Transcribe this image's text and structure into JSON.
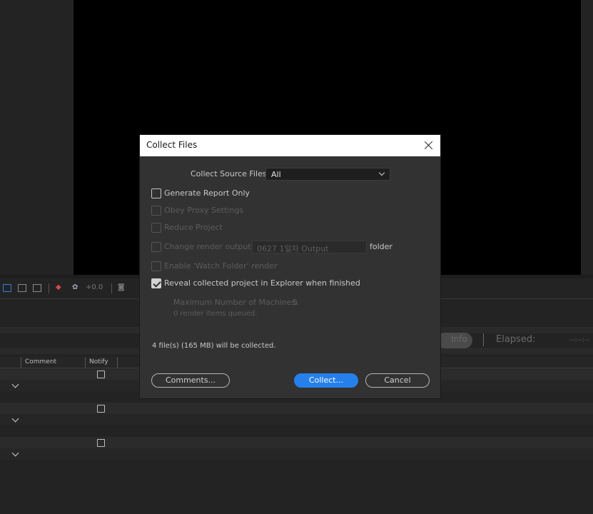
{
  "background": {
    "toolbar": {
      "exposure_value": "+0.0"
    },
    "render_queue": {
      "columns": [
        "Comment",
        "Notify"
      ],
      "info_button": "Info",
      "elapsed_label": "Elapsed:",
      "elapsed_value": "--:--:--"
    }
  },
  "dialog": {
    "title": "Collect Files",
    "collect_source": {
      "label": "Collect Source Files:",
      "value": "All"
    },
    "options": {
      "generate_report": {
        "label": "Generate Report Only",
        "checked": false,
        "enabled": true
      },
      "obey_proxy": {
        "label": "Obey Proxy Settings",
        "checked": false,
        "enabled": false
      },
      "reduce_project": {
        "label": "Reduce Project",
        "checked": false,
        "enabled": false
      },
      "change_render_output": {
        "label": "Change render output to",
        "value": "0627 1일차 Output",
        "suffix": "folder",
        "checked": false,
        "enabled": false
      },
      "watch_folder": {
        "label": "Enable 'Watch Folder' render",
        "checked": false,
        "enabled": false
      },
      "reveal_explorer": {
        "label": "Reveal collected project in Explorer when finished",
        "checked": true,
        "enabled": true
      }
    },
    "machines": {
      "label": "Maximum Number of Machines:",
      "value": "5"
    },
    "queued_text": "0 render items queued.",
    "summary": "4 file(s) (165 MB) will be collected.",
    "buttons": {
      "comments": "Comments...",
      "collect": "Collect...",
      "cancel": "Cancel"
    }
  },
  "colors": {
    "accent": "#2680eb",
    "dialog_bg": "#323232",
    "app_bg": "#232323"
  }
}
